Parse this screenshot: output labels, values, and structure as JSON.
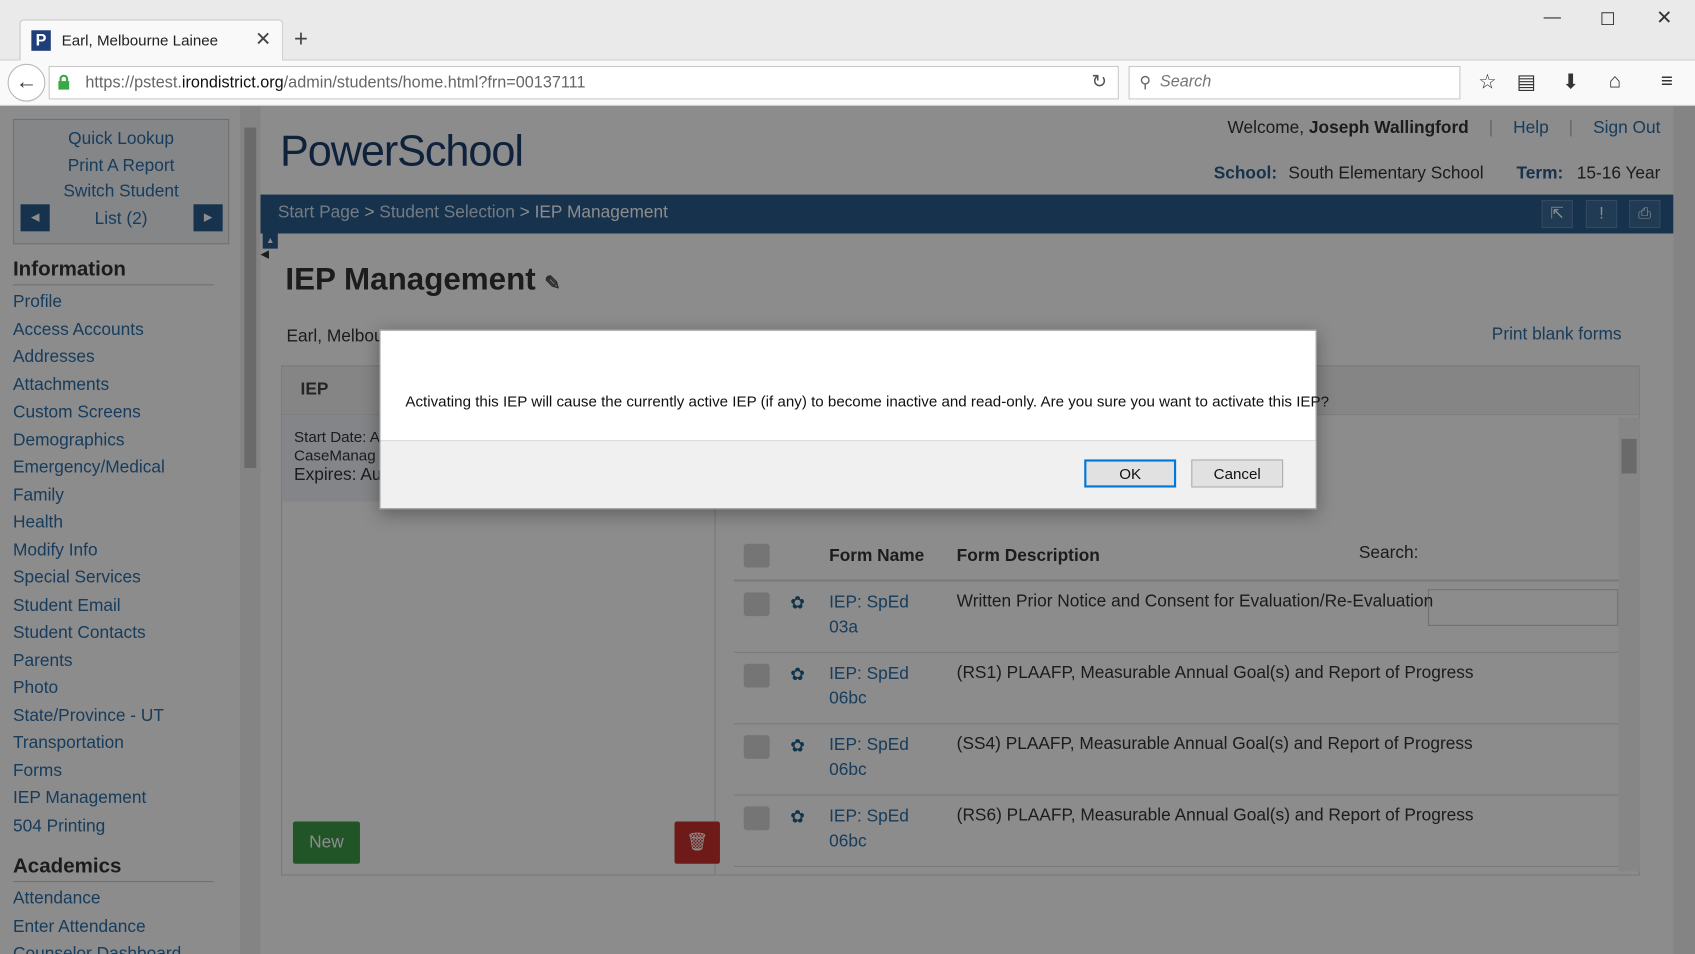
{
  "browser": {
    "tab_title": "Earl, Melbourne Lainee",
    "url_host_prefix": "https://pstest.",
    "url_host_main": "irondistrict.org",
    "url_path": "/admin/students/home.html?frn=00137111",
    "search_placeholder": "Search"
  },
  "header": {
    "welcome_prefix": "Welcome,",
    "user_name": "Joseph Wallingford",
    "help_label": "Help",
    "signout_label": "Sign Out",
    "school_label": "School:",
    "school_value": "South Elementary School",
    "term_label": "Term:",
    "term_value": "15-16 Year",
    "logo_text": "PowerSchool"
  },
  "breadcrumb": {
    "start": "Start Page",
    "selection": "Student Selection",
    "current": "IEP Management",
    "sep": ">"
  },
  "navbox": {
    "quick_lookup": "Quick Lookup",
    "print_report": "Print A Report",
    "switch_student": "Switch Student",
    "list": "List (2)"
  },
  "sidebar": {
    "information_heading": "Information",
    "information_items": [
      "Profile",
      "Access Accounts",
      "Addresses",
      "Attachments",
      "Custom Screens",
      "Demographics",
      "Emergency/Medical",
      "Family",
      "Health",
      "Modify Info",
      "Special Services",
      "Student Email",
      "Student Contacts",
      "Parents",
      "Photo",
      "State/Province - UT",
      "Transportation",
      "Forms",
      "IEP Management",
      "504 Printing"
    ],
    "academics_heading": "Academics",
    "academics_items": [
      "Attendance",
      "Enter Attendance",
      "Counselor Dashboard"
    ]
  },
  "main": {
    "title": "IEP Management",
    "student_name_partial": "Earl, Melbou",
    "print_blank_forms": "Print blank forms",
    "iep_panel_title": "IEP",
    "start_date_partial": "Start Date: A",
    "casemanager_partial": "CaseManag",
    "expires_partial": "Expires: Au",
    "new_button": "New",
    "search_label": "Search:",
    "search_value": "",
    "col_form_name": "Form Name",
    "col_form_desc": "Form Description",
    "forms": [
      {
        "name": "IEP: SpEd 03a",
        "desc": "Written Prior Notice and Consent for Evaluation/Re-Evaluation"
      },
      {
        "name": "IEP: SpEd 06bc",
        "desc": "(RS1) PLAAFP, Measurable Annual Goal(s) and Report of Progress"
      },
      {
        "name": "IEP: SpEd 06bc",
        "desc": "(SS4) PLAAFP, Measurable Annual Goal(s) and Report of Progress"
      },
      {
        "name": "IEP: SpEd 06bc",
        "desc": "(RS6) PLAAFP, Measurable Annual Goal(s) and Report of Progress"
      }
    ]
  },
  "dialog": {
    "message": "Activating this IEP will cause the currently active IEP (if any) to become inactive and read-only. Are you sure you want to activate this IEP?",
    "ok_label": "OK",
    "cancel_label": "Cancel"
  }
}
